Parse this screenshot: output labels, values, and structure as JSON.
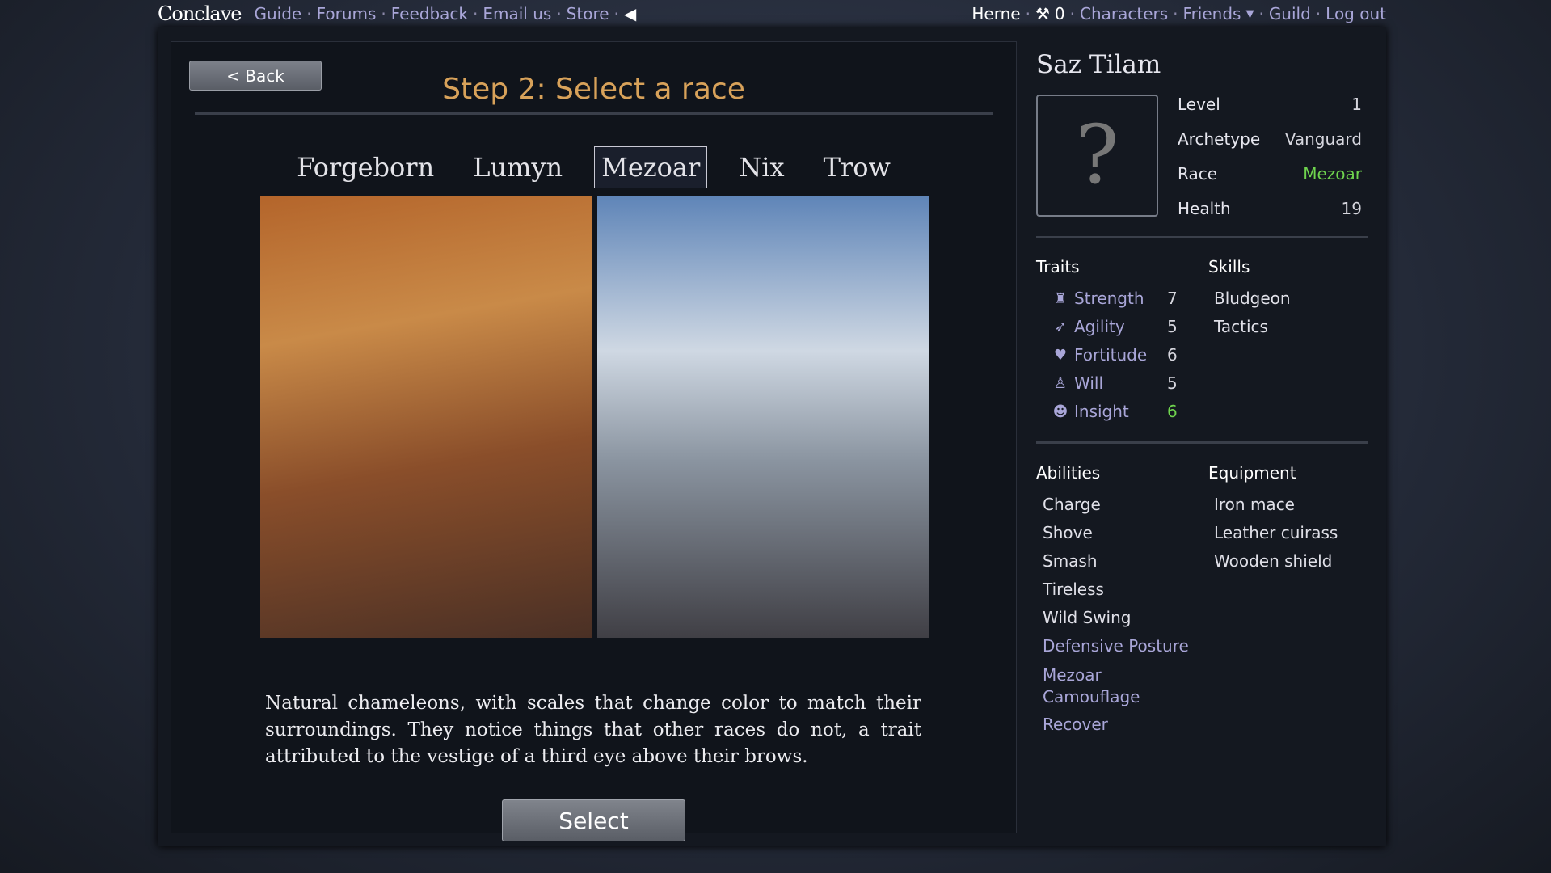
{
  "nav": {
    "logo": "Conclave",
    "left": [
      "Guide",
      "Forums",
      "Feedback",
      "Email us",
      "Store"
    ],
    "user": "Herne",
    "tokens": "0",
    "right": [
      "Characters",
      "Friends",
      "Guild",
      "Log out"
    ]
  },
  "header": {
    "back": "< Back",
    "title": "Step 2: Select a race"
  },
  "tabs": [
    "Forgeborn",
    "Lumyn",
    "Mezoar",
    "Nix",
    "Trow"
  ],
  "active_tab": "Mezoar",
  "description": "Natural chameleons, with scales that change color to match their surroundings. They notice things that other races do not, a trait attributed to the vestige of a third eye above their brows.",
  "select": "Select",
  "character": {
    "name": "Saz Tilam",
    "portrait": "?",
    "stats": [
      {
        "label": "Level",
        "value": "1"
      },
      {
        "label": "Archetype",
        "value": "Vanguard"
      },
      {
        "label": "Race",
        "value": "Mezoar"
      },
      {
        "label": "Health",
        "value": "19"
      }
    ],
    "traits_label": "Traits",
    "skills_label": "Skills",
    "traits": [
      {
        "icon": "strength-icon",
        "label": "Strength",
        "value": "7"
      },
      {
        "icon": "agility-icon",
        "label": "Agility",
        "value": "5"
      },
      {
        "icon": "fortitude-icon",
        "label": "Fortitude",
        "value": "6"
      },
      {
        "icon": "will-icon",
        "label": "Will",
        "value": "5"
      },
      {
        "icon": "insight-icon",
        "label": "Insight",
        "value": "6"
      }
    ],
    "skills": [
      "Bludgeon",
      "Tactics"
    ],
    "abilities_label": "Abilities",
    "equipment_label": "Equipment",
    "abilities": [
      "Charge",
      "Shove",
      "Smash",
      "Tireless",
      "Wild Swing",
      "Defensive Posture",
      "Mezoar Camouflage",
      "Recover"
    ],
    "equipment": [
      "Iron mace",
      "Leather cuirass",
      "Wooden shield"
    ]
  },
  "colors": {
    "accent": "#d8a25a",
    "link": "#a9a6d8",
    "highlight": "#6fd44e"
  }
}
